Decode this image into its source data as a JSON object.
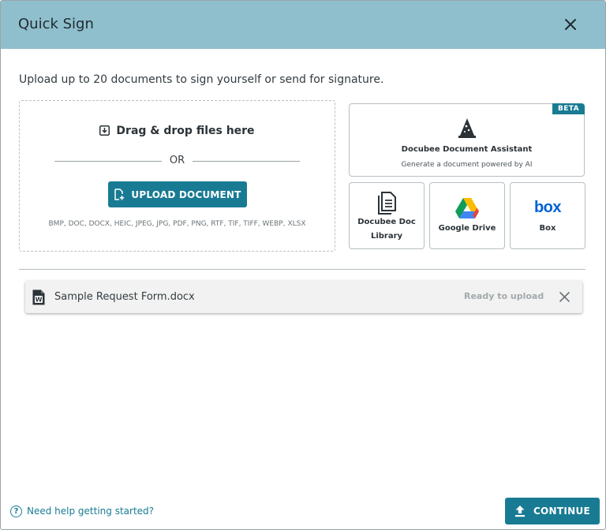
{
  "dialog": {
    "title": "Quick Sign",
    "subtitle": "Upload up to 20 documents to sign yourself or send for signature."
  },
  "dropzone": {
    "drag_label": "Drag & drop files here",
    "or_label": "OR",
    "upload_button": "UPLOAD DOCUMENT",
    "formats": "BMP, DOC, DOCX, HEIC, JPEG, JPG, PDF, PNG, RTF, TIF, TIFF, WEBP, XLSX"
  },
  "sources": {
    "assistant": {
      "badge": "BETA",
      "name": "Docubee Document Assistant",
      "description": "Generate a document powered by AI",
      "icon": "wizard-hat-icon"
    },
    "library": {
      "line1": "Docubee Doc",
      "line2": "Library",
      "icon": "document-library-icon"
    },
    "google_drive": {
      "label": "Google Drive",
      "icon": "google-drive-icon"
    },
    "box": {
      "label": "Box",
      "logo_text": "box",
      "icon": "box-logo-icon"
    }
  },
  "files": [
    {
      "name": "Sample Request Form.docx",
      "status": "Ready to upload",
      "icon": "word-file-icon"
    }
  ],
  "footer": {
    "help_link": "Need help getting started?",
    "continue_button": "CONTINUE"
  },
  "colors": {
    "header_bg": "#8fbfcc",
    "accent": "#197b93",
    "box_blue": "#0061d5"
  }
}
